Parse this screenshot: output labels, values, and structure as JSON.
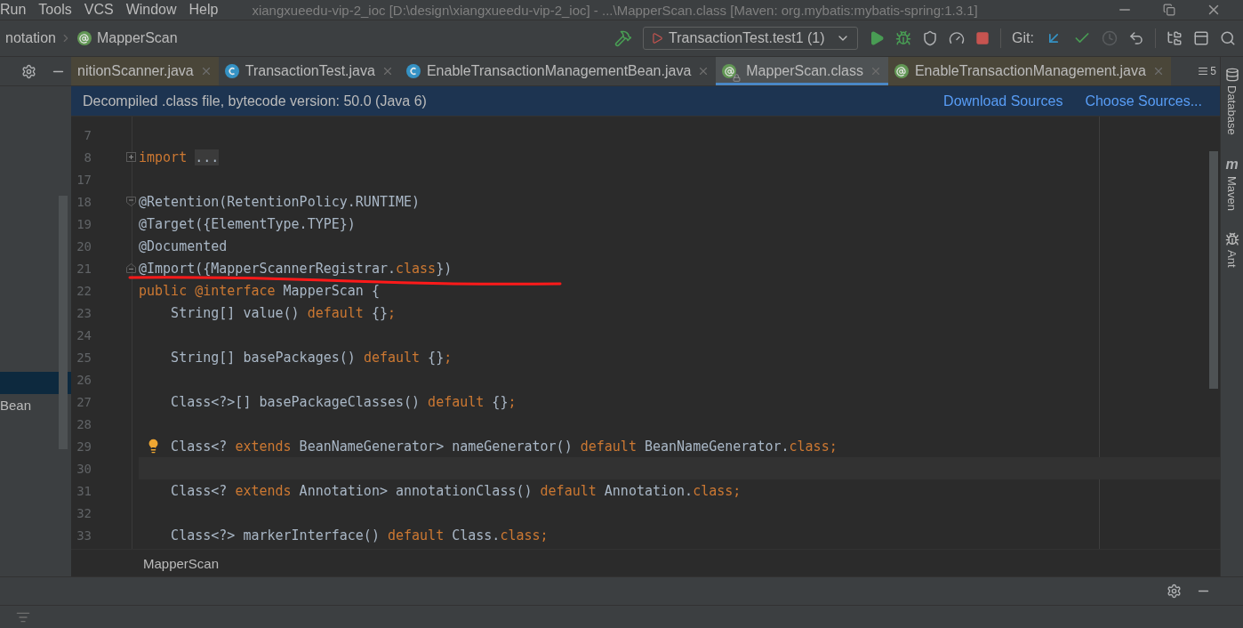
{
  "menu_bar": {
    "items": [
      "Run",
      "Tools",
      "VCS",
      "Window",
      "Help"
    ],
    "title": "xiangxueedu-vip-2_ioc [D:\\design\\xiangxueedu-vip-2_ioc] - ...\\MapperScan.class [Maven: org.mybatis:mybatis-spring:1.3.1]"
  },
  "nav_bar": {
    "breadcrumbs": [
      {
        "label": "notation",
        "kind": "package"
      },
      {
        "label": "MapperScan",
        "kind": "annotation"
      }
    ],
    "run_config": "TransactionTest.test1 (1)",
    "git_label": "Git:"
  },
  "tabs": [
    {
      "label": "nitionScanner.java",
      "kind": "cut",
      "selected": false,
      "library": true,
      "locked": false
    },
    {
      "label": "TransactionTest.java",
      "kind": "test",
      "selected": false,
      "library": false,
      "locked": false
    },
    {
      "label": "EnableTransactionManagementBean.java",
      "kind": "class",
      "selected": false,
      "library": false,
      "locked": false
    },
    {
      "label": "MapperScan.class",
      "kind": "annotation",
      "selected": true,
      "library": false,
      "locked": true
    },
    {
      "label": "EnableTransactionManagement.java",
      "kind": "annotation",
      "selected": false,
      "library": true,
      "locked": false
    }
  ],
  "tab_overflow_count": "5",
  "banner": {
    "message": "Decompiled .class file, bytecode version: 50.0 (Java 6)",
    "actions": [
      "Download Sources",
      "Choose Sources..."
    ]
  },
  "project_panel": {
    "items": [
      {
        "selected": true
      },
      {
        "label": "Bean",
        "selected": false
      }
    ]
  },
  "code": {
    "lines": [
      {
        "number": "7",
        "kind": "plain",
        "current": false,
        "underlined": false
      },
      {
        "number": "8",
        "kind": "collapsed",
        "current": false,
        "underlined": false,
        "segments": [
          {
            "text": "import ",
            "kind": "keyword"
          },
          {
            "text": "...",
            "kind": "folded"
          }
        ]
      },
      {
        "number": "17",
        "kind": "plain",
        "current": false,
        "underlined": false
      },
      {
        "number": "18",
        "kind": "foldstart",
        "current": false,
        "underlined": false,
        "segments": [
          {
            "text": "@Retention(RetentionPolicy.RUNTIME)",
            "kind": "plain"
          }
        ]
      },
      {
        "number": "19",
        "kind": "plain",
        "current": false,
        "underlined": false,
        "segments": [
          {
            "text": "@Target({ElementType.TYPE})",
            "kind": "plain"
          }
        ]
      },
      {
        "number": "20",
        "kind": "plain",
        "current": false,
        "underlined": false,
        "segments": [
          {
            "text": "@Documented",
            "kind": "plain"
          }
        ]
      },
      {
        "number": "21",
        "kind": "foldend",
        "current": false,
        "underlined": true,
        "segments": [
          {
            "text": "@Import({MapperScannerRegistrar.",
            "kind": "plain"
          },
          {
            "text": "class",
            "kind": "keyword"
          },
          {
            "text": "})",
            "kind": "plain"
          }
        ]
      },
      {
        "number": "22",
        "kind": "plain",
        "current": false,
        "underlined": false,
        "segments": [
          {
            "text": "public @interface",
            "kind": "keyword"
          },
          {
            "text": " MapperScan {",
            "kind": "plain"
          }
        ]
      },
      {
        "number": "23",
        "kind": "plain",
        "current": false,
        "underlined": false,
        "segments": [
          {
            "text": "    String[] value() ",
            "kind": "plain"
          },
          {
            "text": "default",
            "kind": "keyword"
          },
          {
            "text": " {}",
            "kind": "plain"
          },
          {
            "text": ";",
            "kind": "keyword"
          }
        ]
      },
      {
        "number": "24",
        "kind": "plain",
        "current": false,
        "underlined": false
      },
      {
        "number": "25",
        "kind": "plain",
        "current": false,
        "underlined": false,
        "segments": [
          {
            "text": "    String[] basePackages() ",
            "kind": "plain"
          },
          {
            "text": "default",
            "kind": "keyword"
          },
          {
            "text": " {}",
            "kind": "plain"
          },
          {
            "text": ";",
            "kind": "keyword"
          }
        ]
      },
      {
        "number": "26",
        "kind": "plain",
        "current": false,
        "underlined": false
      },
      {
        "number": "27",
        "kind": "plain",
        "current": false,
        "underlined": false,
        "segments": [
          {
            "text": "    Class<?>[] basePackageClasses() ",
            "kind": "plain"
          },
          {
            "text": "default",
            "kind": "keyword"
          },
          {
            "text": " {}",
            "kind": "plain"
          },
          {
            "text": ";",
            "kind": "keyword"
          }
        ]
      },
      {
        "number": "28",
        "kind": "plain",
        "current": false,
        "underlined": false
      },
      {
        "number": "29",
        "kind": "hint",
        "current": false,
        "underlined": false,
        "segments": [
          {
            "text": "    Class<? ",
            "kind": "plain"
          },
          {
            "text": "extends",
            "kind": "keyword"
          },
          {
            "text": " BeanNameGenerator> nameGenerator() ",
            "kind": "plain"
          },
          {
            "text": "default",
            "kind": "keyword"
          },
          {
            "text": " BeanNameGenerator.",
            "kind": "plain"
          },
          {
            "text": "class;",
            "kind": "keyword"
          }
        ]
      },
      {
        "number": "30",
        "kind": "plain",
        "current": true,
        "underlined": false
      },
      {
        "number": "31",
        "kind": "plain",
        "current": false,
        "underlined": false,
        "segments": [
          {
            "text": "    Class<? ",
            "kind": "plain"
          },
          {
            "text": "extends",
            "kind": "keyword"
          },
          {
            "text": " Annotation> annotationClass() ",
            "kind": "plain"
          },
          {
            "text": "default",
            "kind": "keyword"
          },
          {
            "text": " Annotation.",
            "kind": "plain"
          },
          {
            "text": "class;",
            "kind": "keyword"
          }
        ]
      },
      {
        "number": "32",
        "kind": "plain",
        "current": false,
        "underlined": false
      },
      {
        "number": "33",
        "kind": "plain",
        "current": false,
        "underlined": false,
        "segments": [
          {
            "text": "    Class<?> markerInterface() ",
            "kind": "plain"
          },
          {
            "text": "default",
            "kind": "keyword"
          },
          {
            "text": " Class.",
            "kind": "plain"
          },
          {
            "text": "class;",
            "kind": "keyword"
          }
        ]
      }
    ]
  },
  "editor_breadcrumb": "MapperScan",
  "right_stripe": [
    {
      "label": "Database",
      "kind": "database"
    },
    {
      "label": "Maven",
      "kind": "maven",
      "glyph": "m"
    },
    {
      "label": "Ant",
      "kind": "ant"
    }
  ]
}
